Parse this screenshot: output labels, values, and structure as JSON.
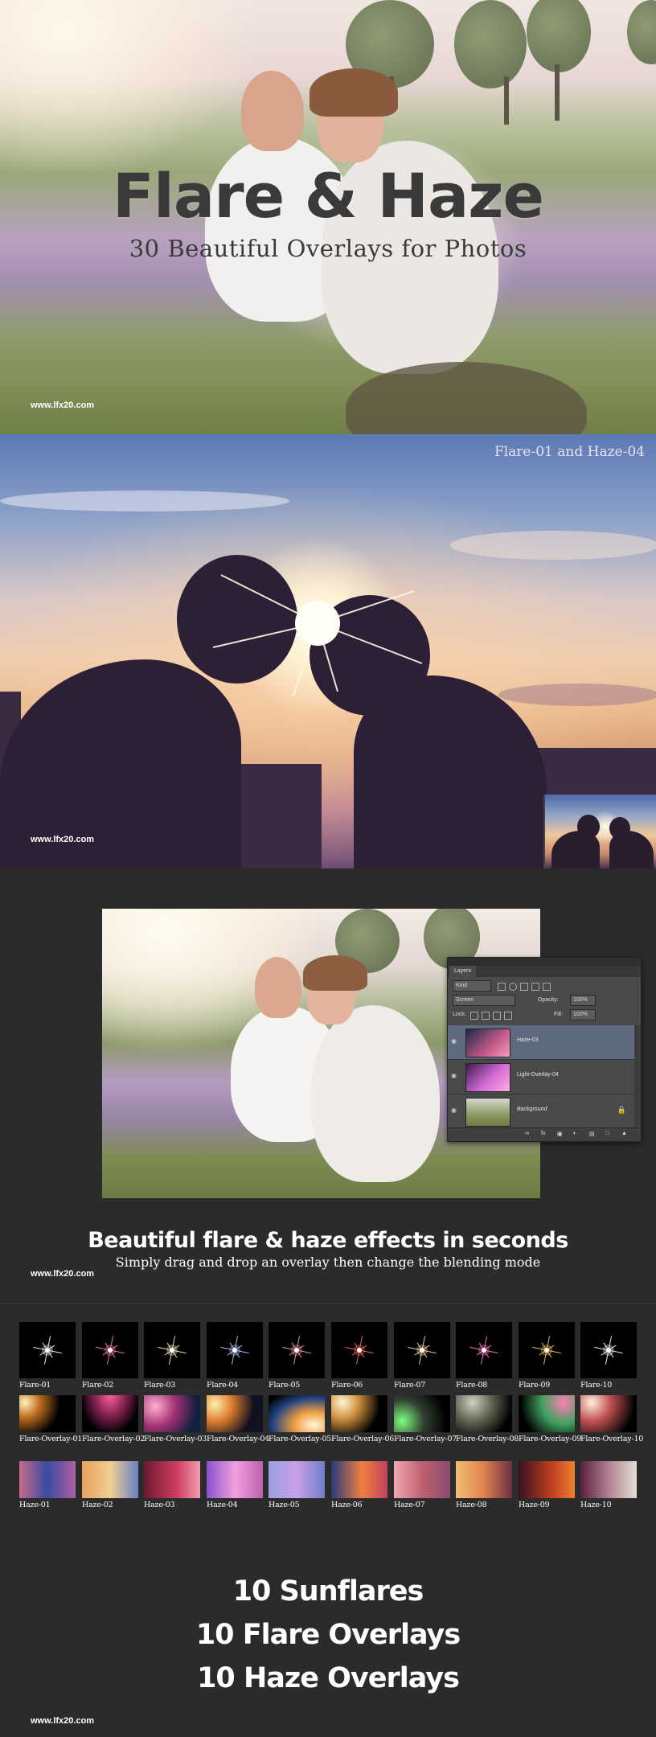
{
  "hero": {
    "title": "Flare & Haze",
    "subtitle": "30 Beautiful Overlays for Photos",
    "watermark": "www.lfx20.com"
  },
  "sunset": {
    "caption": "Flare-01 and Haze-04",
    "watermark": "www.lfx20.com"
  },
  "photoshop": {
    "panel": {
      "tab": "Layers",
      "kind": "Kind",
      "blend_mode": "Screen",
      "opacity_label": "Opacity:",
      "opacity_value": "100%",
      "lock_label": "Lock:",
      "fill_label": "Fill:",
      "fill_value": "100%",
      "layers": [
        "Haze-03",
        "Light-Overlay-04",
        "Background"
      ]
    },
    "heading": "Beautiful flare & haze effects in seconds",
    "subheading": "Simply drag and drop an overlay then change the blending mode",
    "watermark": "www.lfx20.com"
  },
  "grid": {
    "flares": [
      "Flare-01",
      "Flare-02",
      "Flare-03",
      "Flare-04",
      "Flare-05",
      "Flare-06",
      "Flare-07",
      "Flare-08",
      "Flare-09",
      "Flare-10"
    ],
    "flare_colors": [
      "#ffffff",
      "#ff7fb0",
      "#fff2cc",
      "#b8c8ff",
      "#ff9aa8",
      "#ff6a5a",
      "#ffd8b0",
      "#ff80c0",
      "#ffcc66",
      "#ffffff"
    ],
    "flare_overlays": [
      "Flare-Overlay-01",
      "Flare-Overlay-02",
      "Flare-Overlay-03",
      "Flare-Overlay-04",
      "Flare-Overlay-05",
      "Flare-Overlay-06",
      "Flare-Overlay-07",
      "Flare-Overlay-08",
      "Flare-Overlay-09",
      "Flare-Overlay-10"
    ],
    "hazes": [
      "Haze-01",
      "Haze-02",
      "Haze-03",
      "Haze-04",
      "Haze-05",
      "Haze-06",
      "Haze-07",
      "Haze-08",
      "Haze-09",
      "Haze-10"
    ],
    "lines": [
      "10 Sunflares",
      "10 Flare Overlays",
      "10 Haze Overlays"
    ],
    "watermark": "www.lfx20.com"
  }
}
